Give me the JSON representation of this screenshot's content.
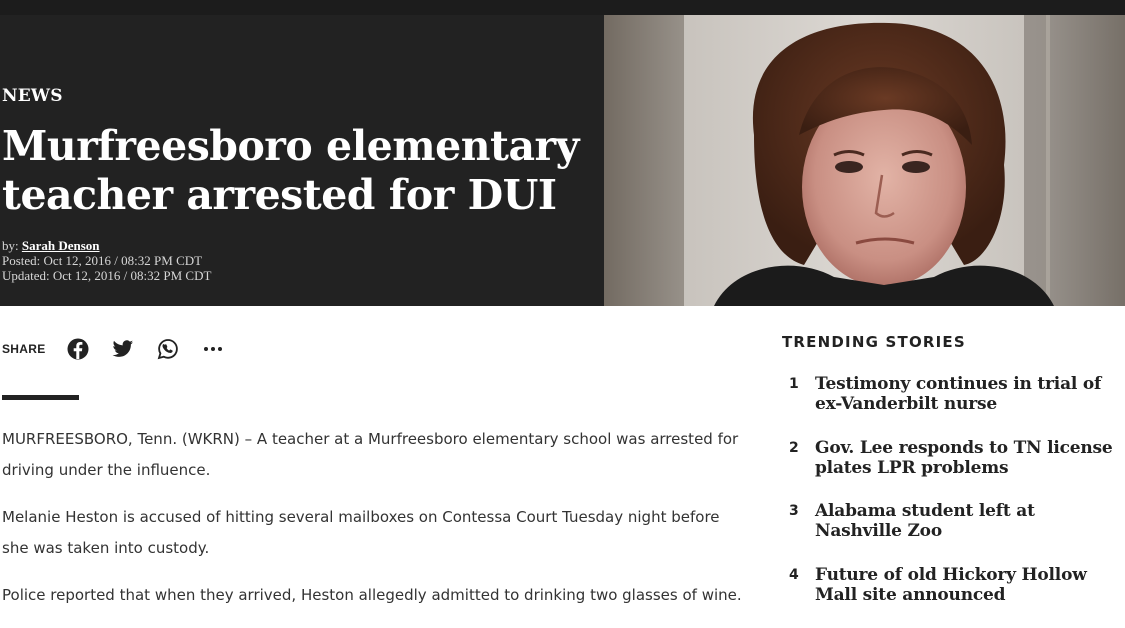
{
  "hero": {
    "category": "NEWS",
    "headline": "Murfreesboro elementary teacher arrested for DUI",
    "byline_prefix": "by:",
    "author": "Sarah Denson",
    "posted": "Posted: Oct 12, 2016 / 08:32 PM CDT",
    "updated": "Updated: Oct 12, 2016 / 08:32 PM CDT"
  },
  "share": {
    "label": "SHARE",
    "icons": [
      "facebook-icon",
      "twitter-icon",
      "whatsapp-icon",
      "more-icon"
    ]
  },
  "article": {
    "paragraphs": [
      "MURFREESBORO, Tenn. (WKRN) – A teacher at a Murfreesboro elementary school was arrested for driving under the influence.",
      "Melanie Heston is accused of hitting several mailboxes on Contessa Court Tuesday night before she was taken into custody.",
      "Police reported that when they arrived, Heston allegedly admitted to drinking two glasses of wine."
    ]
  },
  "trending": {
    "title": "TRENDING STORIES",
    "items": [
      {
        "num": "1",
        "text": "Testimony continues in trial of ex-Vanderbilt nurse"
      },
      {
        "num": "2",
        "text": "Gov. Lee responds to TN license plates LPR problems"
      },
      {
        "num": "3",
        "text": "Alabama student left at Nashville Zoo"
      },
      {
        "num": "4",
        "text": "Future of old Hickory Hollow Mall site announced"
      }
    ]
  },
  "colors": {
    "hero_bg": "#222222",
    "text_dark": "#222222",
    "body_text": "#333333"
  }
}
